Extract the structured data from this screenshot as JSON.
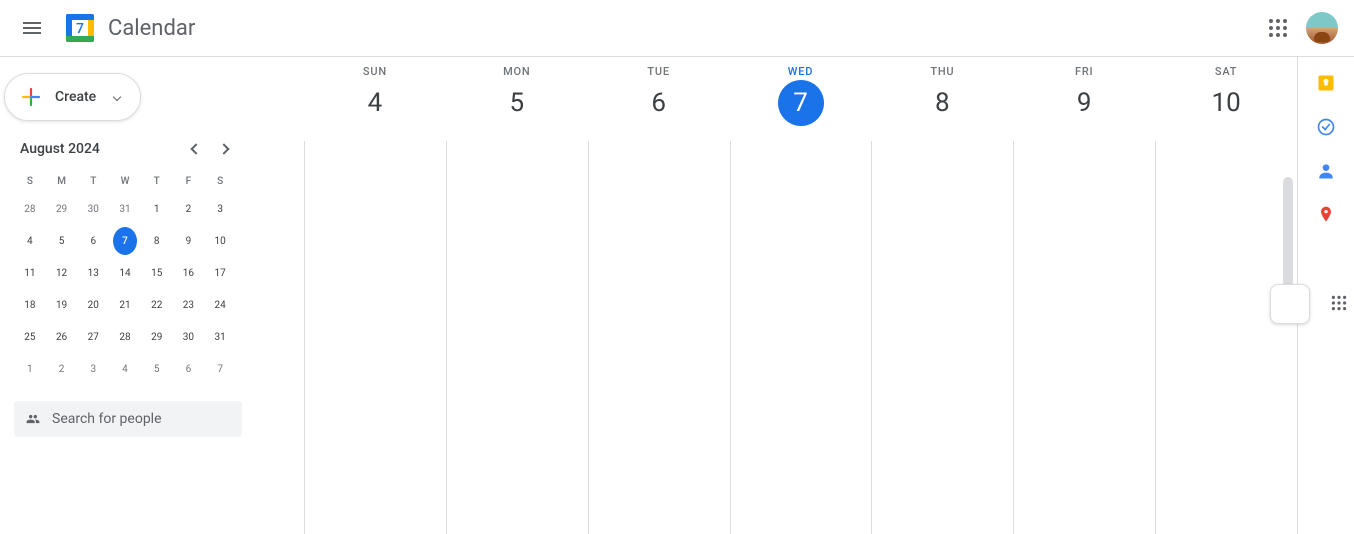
{
  "header": {
    "app_name": "Calendar",
    "logo_day": "7"
  },
  "sidebar": {
    "create_label": "Create",
    "mini_cal": {
      "title": "August 2024",
      "dow": [
        "S",
        "M",
        "T",
        "W",
        "T",
        "F",
        "S"
      ],
      "days": [
        {
          "n": "28",
          "muted": true
        },
        {
          "n": "29",
          "muted": true
        },
        {
          "n": "30",
          "muted": true
        },
        {
          "n": "31",
          "muted": true
        },
        {
          "n": "1"
        },
        {
          "n": "2"
        },
        {
          "n": "3"
        },
        {
          "n": "4"
        },
        {
          "n": "5"
        },
        {
          "n": "6"
        },
        {
          "n": "7",
          "today": true
        },
        {
          "n": "8"
        },
        {
          "n": "9"
        },
        {
          "n": "10"
        },
        {
          "n": "11"
        },
        {
          "n": "12"
        },
        {
          "n": "13"
        },
        {
          "n": "14"
        },
        {
          "n": "15"
        },
        {
          "n": "16"
        },
        {
          "n": "17"
        },
        {
          "n": "18"
        },
        {
          "n": "19"
        },
        {
          "n": "20"
        },
        {
          "n": "21"
        },
        {
          "n": "22"
        },
        {
          "n": "23"
        },
        {
          "n": "24"
        },
        {
          "n": "25"
        },
        {
          "n": "26"
        },
        {
          "n": "27"
        },
        {
          "n": "28"
        },
        {
          "n": "29"
        },
        {
          "n": "30"
        },
        {
          "n": "31"
        },
        {
          "n": "1",
          "muted": true
        },
        {
          "n": "2",
          "muted": true
        },
        {
          "n": "3",
          "muted": true
        },
        {
          "n": "4",
          "muted": true
        },
        {
          "n": "5",
          "muted": true
        },
        {
          "n": "6",
          "muted": true
        },
        {
          "n": "7",
          "muted": true
        }
      ]
    },
    "search_placeholder": "Search for people"
  },
  "week": {
    "days": [
      {
        "dow": "SUN",
        "num": "4",
        "today": false
      },
      {
        "dow": "MON",
        "num": "5",
        "today": false
      },
      {
        "dow": "TUE",
        "num": "6",
        "today": false
      },
      {
        "dow": "WED",
        "num": "7",
        "today": true
      },
      {
        "dow": "THU",
        "num": "8",
        "today": false
      },
      {
        "dow": "FRI",
        "num": "9",
        "today": false
      },
      {
        "dow": "SAT",
        "num": "10",
        "today": false
      }
    ]
  },
  "side_panel": {
    "icons": [
      "keep-icon",
      "tasks-icon",
      "contacts-icon",
      "maps-icon"
    ]
  },
  "colors": {
    "primary": "#1a73e8",
    "border": "#dadce0",
    "text_secondary": "#70757a"
  }
}
